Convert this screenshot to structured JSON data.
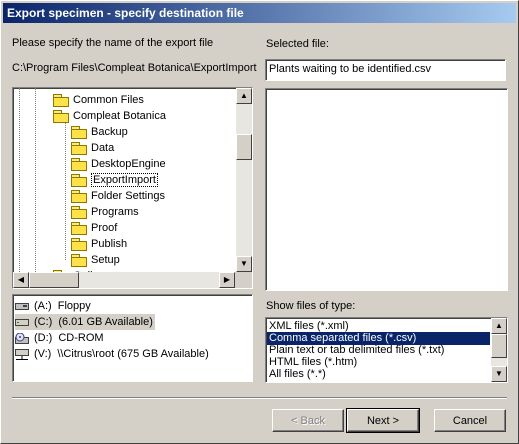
{
  "window": {
    "title": "Export specimen - specify destination file"
  },
  "left": {
    "instruction": "Please specify the name of the export file",
    "current_path": "C:\\Program Files\\Compleat Botanica\\ExportImport",
    "tree": [
      {
        "label": "Common Files",
        "level": 1
      },
      {
        "label": "Compleat Botanica",
        "level": 1
      },
      {
        "label": "Backup",
        "level": 2
      },
      {
        "label": "Data",
        "level": 2
      },
      {
        "label": "DesktopEngine",
        "level": 2
      },
      {
        "label": "ExportImport",
        "level": 2,
        "selected": true
      },
      {
        "label": "Folder Settings",
        "level": 2
      },
      {
        "label": "Programs",
        "level": 2
      },
      {
        "label": "Proof",
        "level": 2
      },
      {
        "label": "Publish",
        "level": 2
      },
      {
        "label": "Setup",
        "level": 2
      },
      {
        "label": "Galle",
        "level": 1
      }
    ],
    "drives": [
      {
        "letter": "(A:)",
        "label": "Floppy",
        "icon": "floppy-icon"
      },
      {
        "letter": "(C:)",
        "label": "(6.01 GB Available)",
        "icon": "harddisk-icon",
        "selected": true
      },
      {
        "letter": "(D:)",
        "label": "CD-ROM",
        "icon": "cdrom-icon"
      },
      {
        "letter": "(V:)",
        "label": "\\\\Citrus\\root  (675 GB Available)",
        "icon": "network-drive-icon"
      }
    ]
  },
  "right": {
    "selected_file_label": "Selected file:",
    "selected_file_value": "Plants waiting to be identified.csv",
    "file_types_label": "Show files of type:",
    "file_types": [
      {
        "label": "XML files (*.xml)"
      },
      {
        "label": "Comma separated files (*.csv)",
        "selected": true
      },
      {
        "label": "Plain text or tab delimited files (*.txt)"
      },
      {
        "label": "HTML files (*.htm)"
      },
      {
        "label": "All files (*.*)"
      }
    ]
  },
  "buttons": {
    "back": "< Back",
    "next": "Next >",
    "cancel": "Cancel"
  },
  "colors": {
    "selection": "#0a246a",
    "dialog": "#d4d0c8",
    "title_start": "#0a246a",
    "title_end": "#a6caf0"
  }
}
